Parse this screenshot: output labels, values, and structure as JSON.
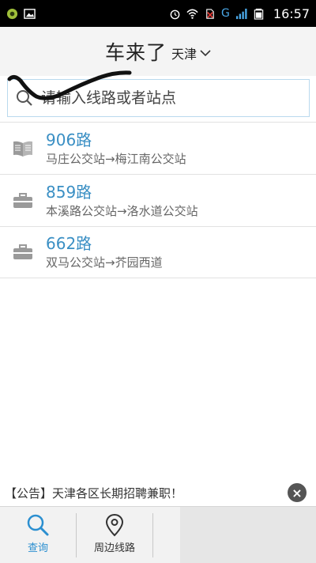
{
  "status_bar": {
    "network": "G",
    "time": "16:57"
  },
  "header": {
    "title": "车来了",
    "city": "天津"
  },
  "search": {
    "placeholder": "请输入线路或者站点"
  },
  "routes": [
    {
      "name": "906路",
      "path": "马庄公交站→梅江南公交站",
      "icon": "book-icon"
    },
    {
      "name": "859路",
      "path": "本溪路公交站→洛水道公交站",
      "icon": "briefcase-icon"
    },
    {
      "name": "662路",
      "path": "双马公交站→芥园西道",
      "icon": "briefcase-icon"
    }
  ],
  "notice": {
    "text": "【公告】天津各区长期招聘兼职！"
  },
  "tabs": [
    {
      "label": "查询",
      "icon": "search-icon",
      "active": true
    },
    {
      "label": "周边线路",
      "icon": "location-pin-icon",
      "active": false
    }
  ],
  "colors": {
    "accent": "#3a8fc4",
    "tab_active": "#2b8fd0",
    "header_bg": "#f4f4f4"
  }
}
